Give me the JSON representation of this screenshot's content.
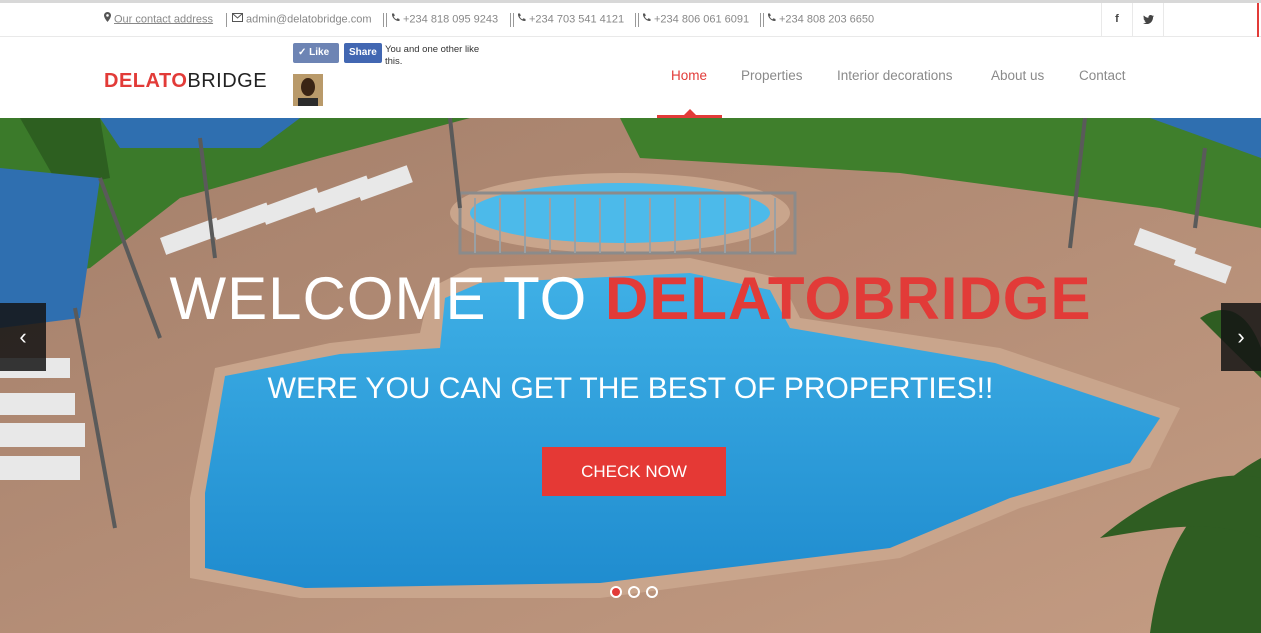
{
  "topbar": {
    "address": "Our contact address",
    "email": "admin@delatobridge.com",
    "phones": [
      "+234 818 095 9243",
      "+234 703 541 4121",
      "+234 806 061 6091",
      "+234 808 203 6650"
    ],
    "social": {
      "facebook": "f",
      "twitter": "t"
    }
  },
  "header": {
    "logo_red": "DELATO",
    "logo_dark": "BRIDGE",
    "fb_like": "✓ Like",
    "fb_share": "Share",
    "fb_text": "You and one other like this."
  },
  "nav": {
    "items": [
      "Home",
      "Properties",
      "Interior decorations",
      "About us",
      "Contact"
    ],
    "active": "Home"
  },
  "hero": {
    "welcome_prefix": "WELCOME TO ",
    "welcome_brand": "DELATOBRIDGE",
    "subtitle": "WERE YOU CAN GET THE BEST OF PROPERTIES!!",
    "cta": "CHECK NOW",
    "prev": "‹",
    "next": "›",
    "slide_count": 3,
    "active_slide": 1
  },
  "colors": {
    "accent": "#e23b38",
    "pool": "#2f9bd4",
    "deck": "#b08a72",
    "grass": "#3d7a2a"
  }
}
